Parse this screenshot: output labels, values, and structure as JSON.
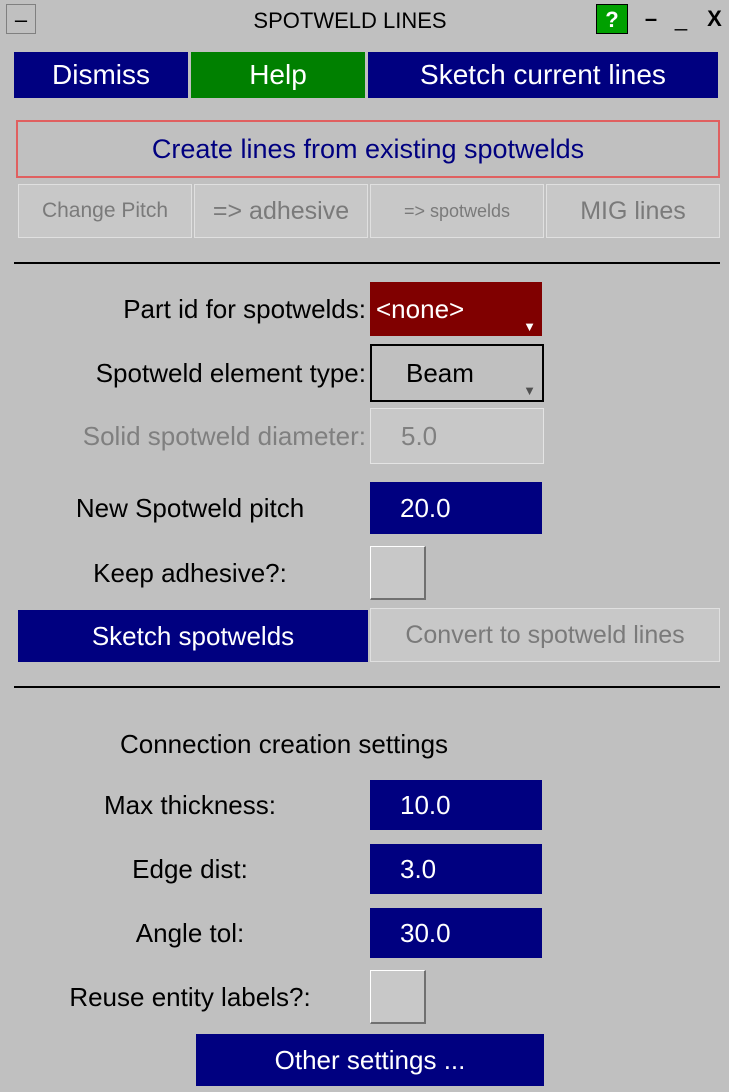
{
  "window": {
    "title": "SPOTWELD LINES",
    "menu_glyph": "–",
    "help_glyph": "?",
    "minimize_glyph": "–",
    "maximize_glyph": "_",
    "close_glyph": "X"
  },
  "toolbar": {
    "dismiss_label": "Dismiss",
    "help_label": "Help",
    "sketch_current_label": "Sketch current lines"
  },
  "create_lines_label": "Create lines from existing spotwelds",
  "tabs": [
    {
      "label": "Change Pitch"
    },
    {
      "label": "=> adhesive"
    },
    {
      "label": "=> spotwelds"
    },
    {
      "label": "MIG lines"
    }
  ],
  "fields": {
    "part_id_label": "Part id for spotwelds:",
    "part_id_value": "<none>",
    "element_type_label": "Spotweld element type:",
    "element_type_value": "Beam",
    "diameter_label": "Solid spotweld diameter:",
    "diameter_value": "5.0",
    "pitch_label": "New Spotweld pitch",
    "pitch_value": "20.0",
    "keep_adhesive_label": "Keep adhesive?:"
  },
  "actions": {
    "sketch_spotwelds": "Sketch spotwelds",
    "convert": "Convert to spotweld lines"
  },
  "connection": {
    "heading": "Connection creation settings",
    "max_thickness_label": "Max thickness:",
    "max_thickness_value": "10.0",
    "edge_dist_label": "Edge dist:",
    "edge_dist_value": "3.0",
    "angle_tol_label": "Angle tol:",
    "angle_tol_value": "30.0",
    "reuse_labels_label": "Reuse entity labels?:",
    "other_settings": "Other settings ..."
  },
  "colors": {
    "navy": "#000080",
    "green": "#008000",
    "dark_red": "#800000",
    "background": "#c0c0c0"
  }
}
